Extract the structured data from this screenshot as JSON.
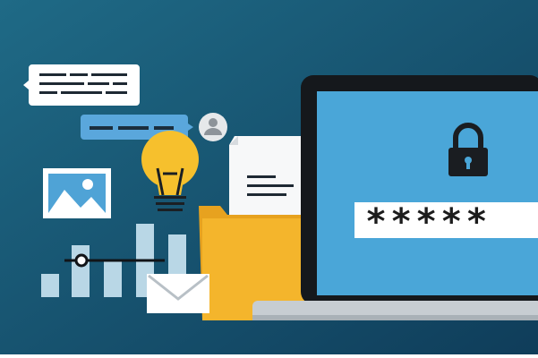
{
  "illustration": {
    "password_masked": "*****",
    "colors": {
      "background_start": "#1f6a86",
      "background_end": "#0f3d5a",
      "screen": "#4aa6d8",
      "laptop_frame": "#15181c",
      "laptop_base": "#c7cdd2",
      "bulb": "#f6c02d",
      "folder": "#f4b52c",
      "bubble_blue": "#5aa7dc",
      "bars": "#b9d7e6"
    },
    "icons": [
      "lock-icon",
      "lightbulb-icon",
      "envelope-icon",
      "image-icon",
      "user-avatar-icon",
      "folder-icon",
      "document-icon",
      "chat-bubble-icon",
      "bar-chart-icon",
      "laptop-icon"
    ]
  }
}
